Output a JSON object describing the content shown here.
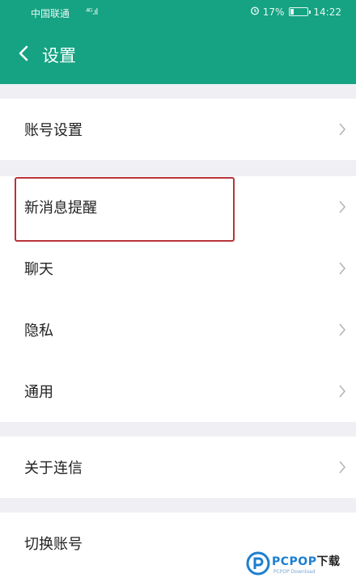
{
  "status_bar": {
    "carrier": "中国联通",
    "signal": "⁴ᴳ.ıl",
    "battery": "17%",
    "battery_level": 0.17,
    "time": "14:22"
  },
  "header": {
    "title": "设置"
  },
  "groups": [
    {
      "items": [
        {
          "label": "账号设置"
        }
      ]
    },
    {
      "items": [
        {
          "label": "新消息提醒"
        },
        {
          "label": "聊天"
        },
        {
          "label": "隐私"
        },
        {
          "label": "通用"
        }
      ]
    },
    {
      "items": [
        {
          "label": "关于连信"
        }
      ]
    },
    {
      "items": [
        {
          "label": "切换账号"
        }
      ]
    }
  ],
  "highlighted_item": "新消息提醒",
  "watermark": {
    "brand": "PCPOP",
    "suffix": "下载",
    "sub": "PCPOP Download"
  },
  "colors": {
    "accent": "#15a383",
    "highlight_border": "#b9343a",
    "background": "#efeff4"
  }
}
